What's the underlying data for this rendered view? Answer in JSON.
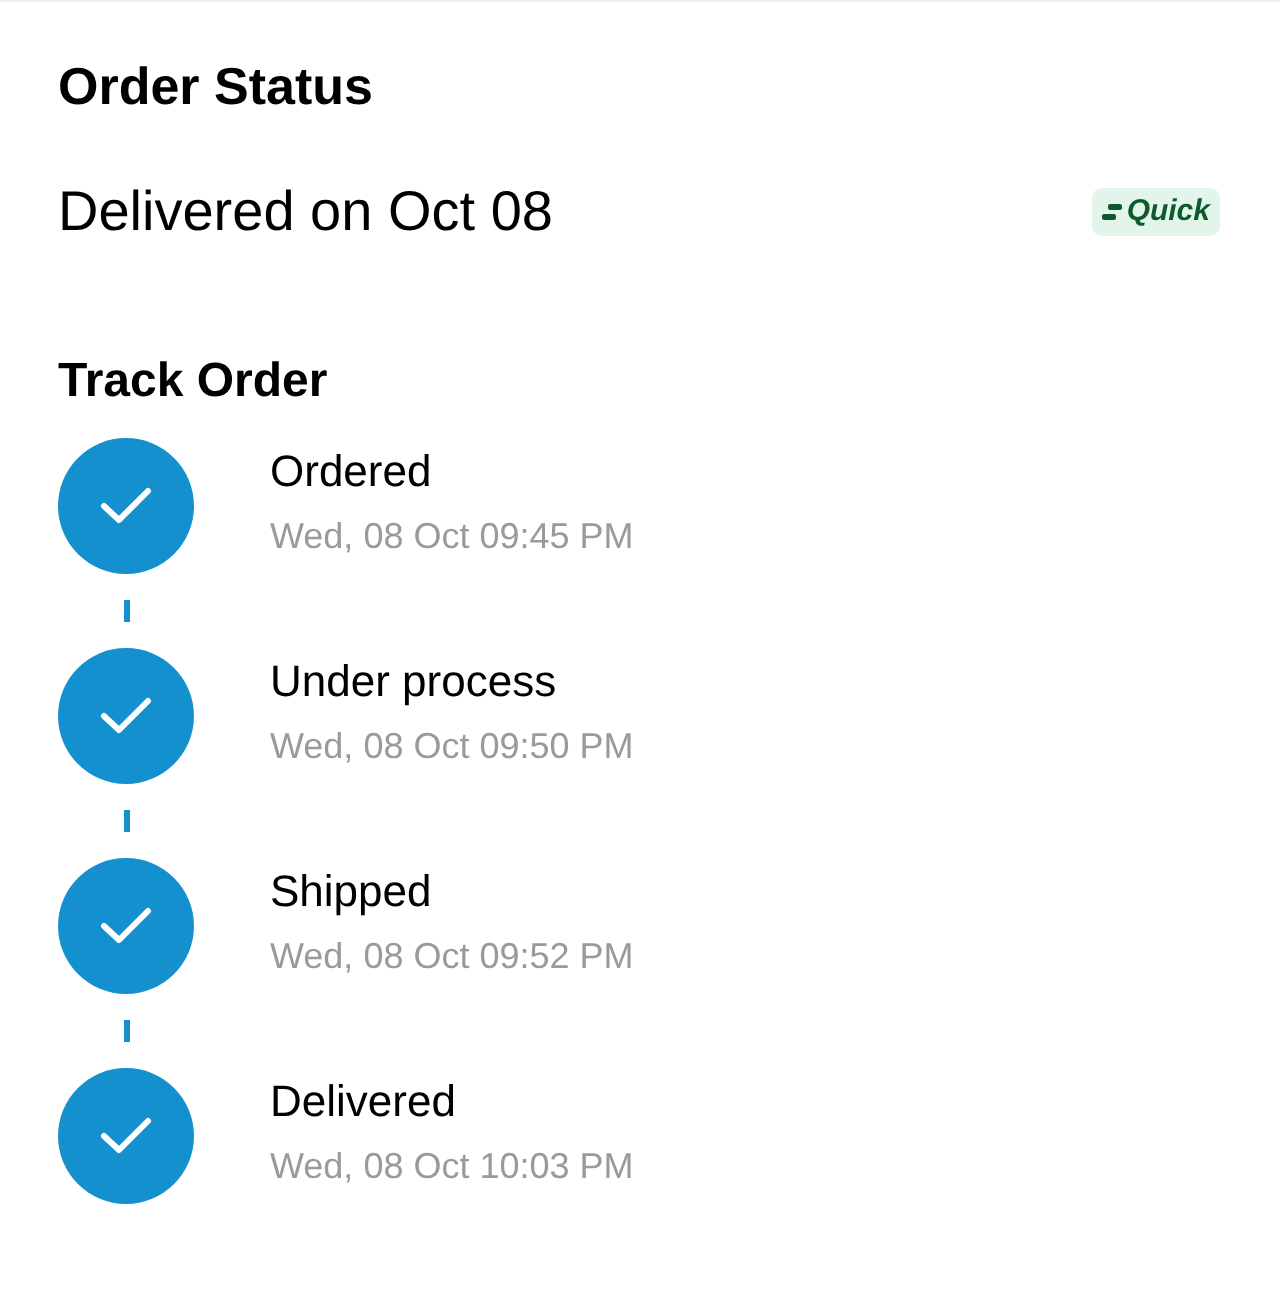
{
  "title": "Order Status",
  "delivery": {
    "text": "Delivered on Oct 08",
    "badge": "Quick"
  },
  "track": {
    "title": "Track Order",
    "steps": [
      {
        "label": "Ordered",
        "time": "Wed, 08 Oct 09:45 PM",
        "done": true
      },
      {
        "label": "Under process",
        "time": "Wed, 08 Oct 09:50 PM",
        "done": true
      },
      {
        "label": "Shipped",
        "time": "Wed, 08 Oct 09:52 PM",
        "done": true
      },
      {
        "label": "Delivered",
        "time": "Wed, 08 Oct 10:03 PM",
        "done": true
      }
    ]
  }
}
